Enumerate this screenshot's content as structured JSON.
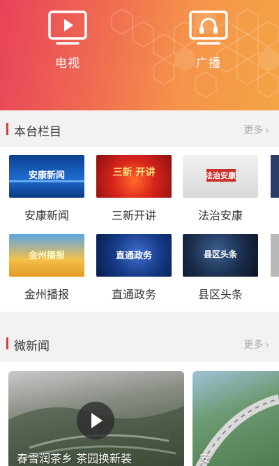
{
  "hero": {
    "tv_label": "电视",
    "radio_label": "广播",
    "tv_icon": "tv-play-icon",
    "radio_icon": "headphones-icon"
  },
  "section_channels": {
    "title": "本台栏目",
    "more": "更多"
  },
  "channels": [
    {
      "name": "安康新闻",
      "thumb_text": "安康新闻"
    },
    {
      "name": "三新开讲",
      "thumb_text": "三新 开讲"
    },
    {
      "name": "法治安康",
      "thumb_text": "法治安康"
    },
    {
      "name": "金州播报",
      "thumb_text": "金州播报"
    },
    {
      "name": "直通政务",
      "thumb_text": "直通政务"
    },
    {
      "name": "县区头条",
      "thumb_text": "县区头条"
    }
  ],
  "section_micro_news": {
    "title": "微新闻",
    "more": "更多"
  },
  "micro_news": [
    {
      "caption": "春雪润茶乡  茶园换新装"
    },
    {
      "caption": "安"
    }
  ],
  "colors": {
    "accent": "#d43f3a",
    "hero_start": "#e8425a",
    "hero_end": "#f4a445"
  }
}
